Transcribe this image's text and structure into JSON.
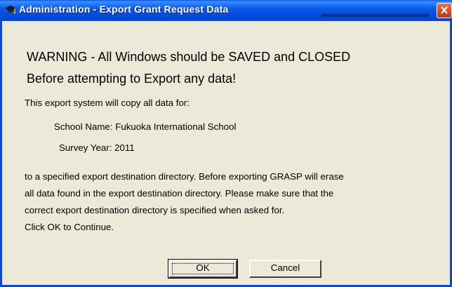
{
  "window": {
    "title": "Administration - Export Grant Request Data",
    "icon": "graduation-cap-icon"
  },
  "message": {
    "warning_line1": "WARNING - All Windows should be SAVED and CLOSED",
    "warning_line2": "Before attempting to Export any data!",
    "intro": "This export system will copy all data for:",
    "school_name": "School Name: Fukuoka International School",
    "survey_year": "Survey Year: 2011",
    "paragraph_line1": "to a specified export destination directory. Before exporting GRASP will erase",
    "paragraph_line2": "all data found in the export destination directory. Please make sure that the",
    "paragraph_line3": "correct export destination directory is specified when asked for.",
    "paragraph_line4": "Click OK to Continue."
  },
  "buttons": {
    "ok_label": "OK",
    "cancel_label": "Cancel"
  },
  "colors": {
    "titlebar": "#0a5ae8",
    "dialog_background": "#ece9d8",
    "close_button": "#d8492a"
  }
}
